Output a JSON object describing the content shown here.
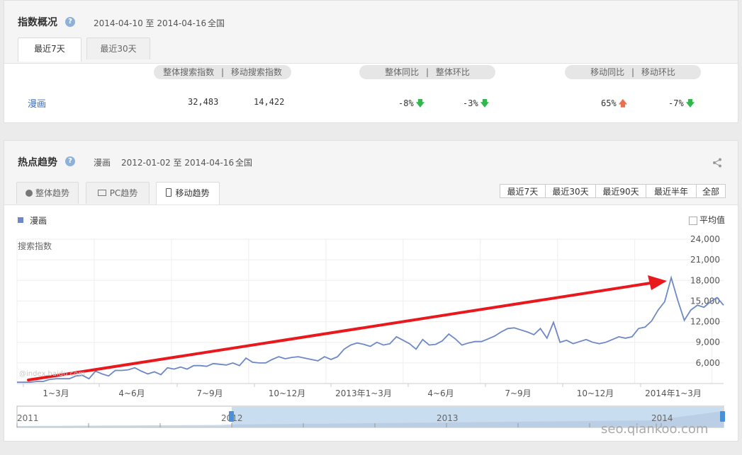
{
  "overview": {
    "title": "指数概况",
    "help": "?",
    "date_range": "2014-04-10 至 2014-04-16",
    "region": "全国",
    "tabs": [
      {
        "label": "最近7天",
        "active": true
      },
      {
        "label": "最近30天",
        "active": false
      }
    ],
    "headers": {
      "search": "整体搜索指数",
      "sep1": "|",
      "mobile_search": "移动搜索指数",
      "yoy": "整体同比",
      "sep2": "|",
      "mom": "整体环比",
      "m_yoy": "移动同比",
      "sep3": "|",
      "m_mom": "移动环比"
    },
    "row": {
      "keyword": "漫画",
      "search": "32,483",
      "mobile_search": "14,422",
      "yoy": "-8%",
      "mom": "-3%",
      "m_yoy": "65%",
      "m_mom": "-7%",
      "arrow_down": "🡇",
      "arrow_up": "🡅"
    }
  },
  "trend": {
    "title": "热点趋势",
    "help": "?",
    "keyword": "漫画",
    "date_range": "2012-01-02 至 2014-04-16",
    "region": "全国",
    "tabs": [
      {
        "label": "整体趋势",
        "icon": "pie-chart-icon",
        "active": false
      },
      {
        "label": "PC趋势",
        "icon": "monitor-icon",
        "active": false
      },
      {
        "label": "移动趋势",
        "icon": "mobile-phone-icon",
        "active": true
      }
    ],
    "ranges": [
      "最近7天",
      "最近30天",
      "最近90天",
      "最近半年",
      "全部"
    ],
    "legend": "漫画",
    "average_label": "平均值",
    "watermark": "@index.baidu.com",
    "site_watermark": "seo.qiankoo.com",
    "navigator_labels": [
      "2011",
      "2012",
      "2013",
      "2014"
    ]
  },
  "chart_data": {
    "type": "line",
    "ylabel": "搜索指数",
    "ylim": [
      3000,
      24000
    ],
    "yticks": [
      "6,000",
      "9,000",
      "12,000",
      "15,000",
      "18,000",
      "21,000",
      "24,000"
    ],
    "xticks": [
      "1~3月",
      "4~6月",
      "7~9月",
      "10~12月",
      "2013年1~3月",
      "4~6月",
      "7~9月",
      "10~12月",
      "2014年1~3月"
    ],
    "series": [
      {
        "name": "漫画",
        "color": "#6d88c4",
        "values": [
          3200,
          3200,
          3200,
          3300,
          3300,
          3600,
          3700,
          3700,
          3700,
          4100,
          4200,
          3700,
          4800,
          4400,
          4100,
          4900,
          4900,
          5000,
          5300,
          4800,
          4400,
          4700,
          4300,
          5300,
          5100,
          5400,
          5100,
          5600,
          5600,
          5500,
          5900,
          5800,
          5700,
          6000,
          5600,
          6700,
          6100,
          6000,
          6000,
          6500,
          6900,
          6600,
          6800,
          6900,
          6700,
          6500,
          6300,
          6900,
          6500,
          6900,
          8000,
          8600,
          8900,
          8700,
          8400,
          9000,
          8600,
          8800,
          9800,
          9300,
          8800,
          8000,
          9400,
          8600,
          8700,
          9200,
          10200,
          9500,
          8600,
          8900,
          9100,
          9100,
          9500,
          9900,
          10500,
          11000,
          11100,
          10800,
          10500,
          10100,
          11000,
          9600,
          11900,
          9000,
          9300,
          8800,
          9100,
          9400,
          9000,
          8800,
          9000,
          9400,
          9800,
          9600,
          9800,
          11000,
          11200,
          12100,
          13700,
          14900,
          18400,
          15100,
          12200,
          13700,
          14400,
          14100,
          14900,
          15500,
          14400
        ]
      }
    ],
    "grid": true,
    "legend": "top-left"
  },
  "annotation": {
    "color": "#e8181c"
  }
}
